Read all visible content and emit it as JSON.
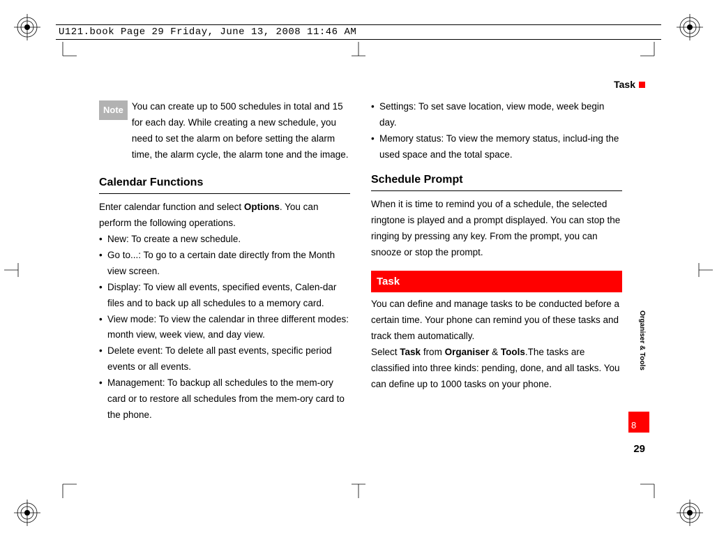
{
  "header": "U121.book  Page 29  Friday, June 13, 2008  11:46 AM",
  "doc_header": "Task",
  "note_label": " Note",
  "note_body": "You can create up to 500 schedules in total and 15 for each day. While creating a new schedule, you need to set the alarm on before setting the alarm time, the alarm cycle, the alarm tone and the image.",
  "cal_func_heading": "Calendar Functions",
  "cal_intro_pre": "Enter calendar function and select ",
  "cal_intro_bold": "Options",
  "cal_intro_post": ". You can perform the following operations.",
  "cal_items": [
    "New: To create a new schedule.",
    "Go to...: To go to a certain date directly from the Month view screen.",
    "Display: To view all events, specified events, Calen-dar files and to back up all schedules to a memory card.",
    "View mode: To view the calendar in three different modes: month view, week view, and day view.",
    "Delete event: To delete all past events, specific period events or all events.",
    "Management: To backup all schedules to the mem-ory card or to restore all schedules from the mem-ory card to the phone."
  ],
  "col2_items": [
    "Settings: To set save location, view mode, week begin day.",
    "Memory status: To view the memory status, includ-ing the used space and the total space."
  ],
  "sched_heading": "Schedule Prompt",
  "sched_body": "When it is time to remind you of a schedule, the selected ringtone is played and a prompt displayed. You can stop the ringing by pressing any key. From the prompt, you can snooze or stop the prompt.",
  "task_banner": "Task",
  "task_p1": "You can define and manage tasks to be conducted before a certain time. Your phone can remind you of these tasks and track them automatically.",
  "task_p2_pre": "Select ",
  "task_p2_b1": "Task",
  "task_p2_m1": " from ",
  "task_p2_b2": "Organiser",
  "task_p2_m2": " & ",
  "task_p2_b3": "Tools",
  "task_p2_post": ".The tasks are classified into three kinds: pending, done, and all tasks. You can define up to 1000 tasks on your phone.",
  "side_label": "Organiser & Tools",
  "chapter_num": "8",
  "page_num": "29"
}
